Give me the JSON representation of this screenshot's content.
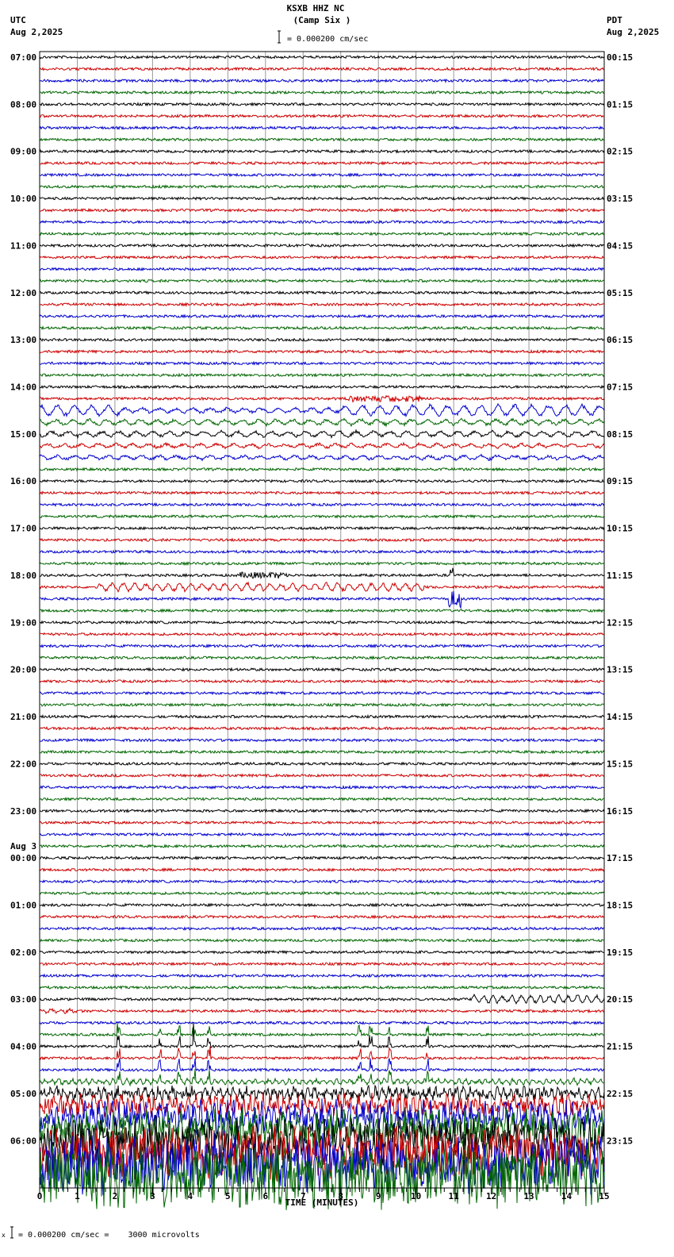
{
  "chart_data": {
    "type": "line",
    "title": "KSXB HHZ NC",
    "subtitle": "(Camp Six )",
    "left_tz": "UTC",
    "left_date": "Aug 2,2025",
    "right_tz": "PDT",
    "right_date": "Aug 2,2025",
    "scale_label": "= 0.000200 cm/sec",
    "footer_scale": "= 0.000200 cm/sec =    3000 microvolts",
    "footer_mark": "x",
    "xlabel": "TIME (MINUTES)",
    "xlim": [
      0,
      15
    ],
    "x_ticks": [
      "0",
      "1",
      "2",
      "3",
      "4",
      "5",
      "6",
      "7",
      "8",
      "9",
      "10",
      "11",
      "12",
      "13",
      "14",
      "15"
    ],
    "date_change_label": "Aug 3",
    "left_hour_labels": [
      "07:00",
      "08:00",
      "09:00",
      "10:00",
      "11:00",
      "12:00",
      "13:00",
      "14:00",
      "15:00",
      "16:00",
      "17:00",
      "18:00",
      "19:00",
      "20:00",
      "21:00",
      "22:00",
      "23:00",
      "00:00",
      "01:00",
      "02:00",
      "03:00",
      "04:00",
      "05:00",
      "06:00"
    ],
    "right_hour_labels": [
      "00:15",
      "01:15",
      "02:15",
      "03:15",
      "04:15",
      "05:15",
      "06:15",
      "07:15",
      "08:15",
      "09:15",
      "10:15",
      "11:15",
      "12:15",
      "13:15",
      "14:15",
      "15:15",
      "16:15",
      "17:15",
      "18:15",
      "19:15",
      "20:15",
      "21:15",
      "22:15",
      "23:15"
    ],
    "traces_per_hour": 4,
    "trace_colors": [
      "#000000",
      "#cc0000",
      "#0000cc",
      "#006600"
    ],
    "grid": true
  }
}
